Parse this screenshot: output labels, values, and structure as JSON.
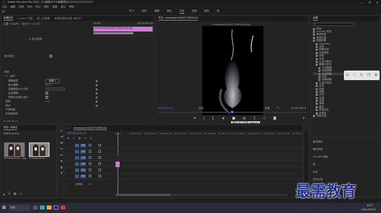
{
  "window": {
    "title": "Adobe Premiere Pro 2020 - D:\\视频\\1015\\新建项目\\1\\2\\1\\2\\1\\2\\1\\2\\1\\2 *",
    "menu": [
      "文件",
      "编辑",
      "剪辑",
      "序列",
      "标记",
      "图形",
      "视图",
      "窗口",
      "帮助"
    ],
    "controls": [
      "—",
      "❐",
      "✕"
    ]
  },
  "workspaces": [
    "学习",
    "组件",
    "编辑",
    "颜色",
    "效果",
    "音频",
    "图形",
    "库"
  ],
  "source_panel": {
    "tabs": [
      "效果控件",
      "Lumetri 范围",
      "源: (无剪辑)",
      "音频剪辑混合器: 新序列"
    ],
    "master_label": "主要 * 18.JPG",
    "sequence_label": "新序列 * 18.JPG",
    "timecode_a": "00:00",
    "timecode_b": "00:00:05:00",
    "clip_label": "mmexport1630277894224.jpg",
    "video_label": "视频",
    "motion_label": "运动",
    "opacity_label": "不透明度",
    "time_remap_label": "时间重映射",
    "effect_header": "fx  复合模糊",
    "param_labels": [
      "模糊图层",
      "最大模糊",
      "如果图层大小不同",
      "反转模糊",
      "伸缩对应图以适合"
    ],
    "param_values": [
      "视频 1",
      "20.0",
      "",
      "",
      ""
    ],
    "extra_labels": [
      "显示项目",
      "旋转",
      "锚点"
    ],
    "bottom_time": "00:00:02:11"
  },
  "program": {
    "tab": "节目: mmexport1630277894224",
    "file_title": "mmexport1630277894224.jpg",
    "timecode": "00:00:02:11",
    "fit_label": "适合",
    "quality": "完整",
    "duration": "00:00:05:00",
    "tooltip": "播放-停止切换 (Space)"
  },
  "project": {
    "tab": "项目: 未命名",
    "path": "未命名.prproj",
    "items": [
      {
        "name": "mmexport16...jpg",
        "duration": "5:00"
      },
      {
        "name": "mmexport16...",
        "duration": "5:00"
      }
    ]
  },
  "timeline": {
    "tab": "mmexport1630277894224",
    "timecode": "00:00:02:11",
    "ruler": [
      "00:00",
      "00:00:01:00",
      "00:00:02:00",
      "00:00:03:00",
      "00:00:04:00",
      "00:00:05:00",
      "00:00:06:00",
      "00:00:07:00",
      "00:00:08:00",
      "00:00:09:00",
      "00:00:10:00",
      "00:00:11:00",
      "00:00:12:00"
    ],
    "tracks": [
      "V3",
      "V2",
      "V1",
      "A1",
      "A2",
      "A3"
    ],
    "master_label": "主声道",
    "master_value": "0.0"
  },
  "effects": {
    "tab": "效果",
    "search_placeholder": "搜索",
    "tree": [
      {
        "label": "预设",
        "indent": 0
      },
      {
        "label": "Lumetri 预设",
        "indent": 0
      },
      {
        "label": "音频效果",
        "indent": 0
      },
      {
        "label": "音频过渡",
        "indent": 0
      },
      {
        "label": "视频效果",
        "indent": 0
      },
      {
        "label": "Obsolete",
        "indent": 1
      },
      {
        "label": "变换",
        "indent": 1
      },
      {
        "label": "图像控制",
        "indent": 1
      },
      {
        "label": "实用程序",
        "indent": 1
      },
      {
        "label": "扭曲",
        "indent": 1
      },
      {
        "label": "时间",
        "indent": 1
      },
      {
        "label": "杂色与颗粒",
        "indent": 1
      },
      {
        "label": "模糊与锐化",
        "indent": 1
      },
      {
        "label": "方向模糊",
        "indent": 2
      },
      {
        "label": "相机模糊",
        "indent": 2
      },
      {
        "label": "钝化蒙版",
        "indent": 2
      },
      {
        "label": "锐化",
        "indent": 2
      },
      {
        "label": "高斯模糊",
        "indent": 2
      },
      {
        "label": "沉浸式视频",
        "indent": 1
      },
      {
        "label": "生成",
        "indent": 1
      },
      {
        "label": "视频",
        "indent": 1
      },
      {
        "label": "调整",
        "indent": 1
      },
      {
        "label": "过时",
        "indent": 1
      },
      {
        "label": "过渡",
        "indent": 1
      },
      {
        "label": "透视",
        "indent": 1
      },
      {
        "label": "通道",
        "indent": 1
      },
      {
        "label": "键控",
        "indent": 1
      },
      {
        "label": "颜色校正",
        "indent": 1
      },
      {
        "label": "风格化",
        "indent": 1
      },
      {
        "label": "视频过渡",
        "indent": 0
      }
    ],
    "bottom": [
      "基本图形",
      "基本声音",
      "Lumetri 颜色",
      "库",
      "标记",
      "历史记录",
      "信息"
    ]
  },
  "taskbar": {
    "search": "搜索",
    "time": "8:37",
    "date": "2021/10/15"
  },
  "watermark": "最需教育"
}
